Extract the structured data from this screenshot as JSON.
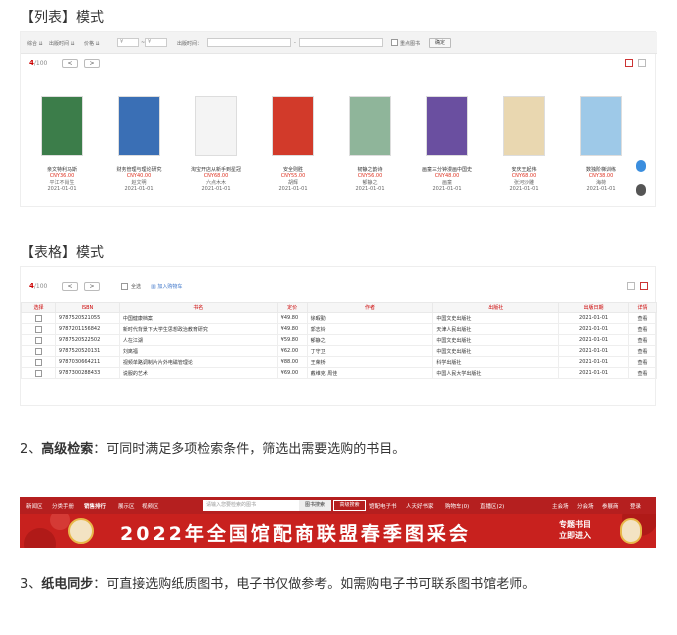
{
  "list_mode": {
    "heading": "【列表】模式",
    "toolbar": {
      "sort_labels": [
        "综合 ⇊",
        "出版时间 ⇊",
        "价格 ⇊"
      ],
      "price_from": "¥",
      "price_sep": "~",
      "price_to": "¥",
      "pub_time_label": "出版时间：",
      "date_sep": "-",
      "paper_book_label": "重点图书",
      "confirm_button": "确定"
    },
    "count_current": "4",
    "count_total": "/100",
    "pager_prev": "<",
    "pager_next": ">",
    "books": [
      {
        "title": "亲文特利马斯",
        "price": "CNY36.00",
        "author": "平江不肖生",
        "date": "2021-01-01",
        "color": "#3c7d4a"
      },
      {
        "title": "财务管理与理论研究",
        "price": "CNY40.00",
        "author": "赵文明",
        "date": "2021-01-01",
        "color": "#3a6fb5"
      },
      {
        "title": "淘宝开店从新手到星冠",
        "price": "CNY68.00",
        "author": "六点木木",
        "date": "2021-01-01",
        "color": "#f4f4f4"
      },
      {
        "title": "安全则胜",
        "price": "CNY55.00",
        "author": "胡辉",
        "date": "2021-01-01",
        "color": "#d23a2a"
      },
      {
        "title": "韧静之韵诗",
        "price": "CNY56.00",
        "author": "郁静之",
        "date": "2021-01-01",
        "color": "#8fb59a"
      },
      {
        "title": "画童三分钟漫画中国史",
        "price": "CNY48.00",
        "author": "画童",
        "date": "2021-01-01",
        "color": "#6a4fa0"
      },
      {
        "title": "安庆王起伟",
        "price": "CNY68.00",
        "author": "张河沙雕",
        "date": "2021-01-01",
        "color": "#e9d7b0"
      },
      {
        "title": "数独阶梯训练",
        "price": "CNY38.00",
        "author": "海荷",
        "date": "2021-01-01",
        "color": "#9ec9e8"
      }
    ]
  },
  "table_mode": {
    "heading": "【表格】模式",
    "count_current": "4",
    "count_total": "/100",
    "pager_prev": "<",
    "pager_next": ">",
    "select_all_label": "全选",
    "add_to_cart_label": "加入购物车",
    "columns": [
      "选择",
      "ISBN",
      "书名",
      "定价",
      "作者",
      "出版社",
      "出版日期",
      "详情"
    ],
    "rows": [
      {
        "isbn": "9787520521055",
        "title": "中国健康档案",
        "price": "¥49.80",
        "author": "徐暇勤",
        "publisher": "中国文史出版社",
        "date": "2021-01-01",
        "detail": "查看"
      },
      {
        "isbn": "9787201156842",
        "title": "新时代背景下大学生思想政治教育研究",
        "price": "¥49.80",
        "author": "郭志铃",
        "publisher": "天津人民出版社",
        "date": "2021-01-01",
        "detail": "查看"
      },
      {
        "isbn": "9787520522502",
        "title": "人在江湖",
        "price": "¥59.80",
        "author": "郁静之",
        "publisher": "中国文史出版社",
        "date": "2021-01-01",
        "detail": "查看"
      },
      {
        "isbn": "9787520520131",
        "title": "刘离福",
        "price": "¥62.00",
        "author": "丁守卫",
        "publisher": "中国文史出版社",
        "date": "2021-01-01",
        "detail": "查看"
      },
      {
        "isbn": "9787030664211",
        "title": "视频单路调制片片外电磁管理论",
        "price": "¥88.00",
        "author": "王荣桥",
        "publisher": "科学出版社",
        "date": "2021-01-01",
        "detail": "查看"
      },
      {
        "isbn": "9787300288433",
        "title": "说服的艺术",
        "price": "¥69.00",
        "author": "戴维克 周佳",
        "publisher": "中国人民大学出版社",
        "date": "2021-01-01",
        "detail": "查看"
      }
    ]
  },
  "para_search": {
    "number": "2、",
    "title": "高级检索",
    "text": "：可同时满足多项检索条件，筛选出需要选购的书目。"
  },
  "banner": {
    "nav_items": [
      "新闻区",
      "分类手册",
      "销售排行",
      "展示区",
      "视频区"
    ],
    "search_placeholder": "请输入您要检索的图书",
    "search_button": "图书搜索",
    "advanced_search": "高级搜索",
    "right_items": [
      "馆配电子书",
      "人天好书家",
      "购物车(0)",
      "直播区(2)"
    ],
    "user_items": [
      "主会场",
      "分会场",
      "参展商",
      "登录"
    ],
    "title": "2022年全国馆配商联盟春季图采会",
    "cta_line1": "专题书目",
    "cta_line2": "立即进入"
  },
  "para_sync": {
    "number": "3、",
    "title": "纸电同步",
    "text": "：可直接选购纸质图书，电子书仅做参考。如需购电子书可联系图书馆老师。"
  }
}
